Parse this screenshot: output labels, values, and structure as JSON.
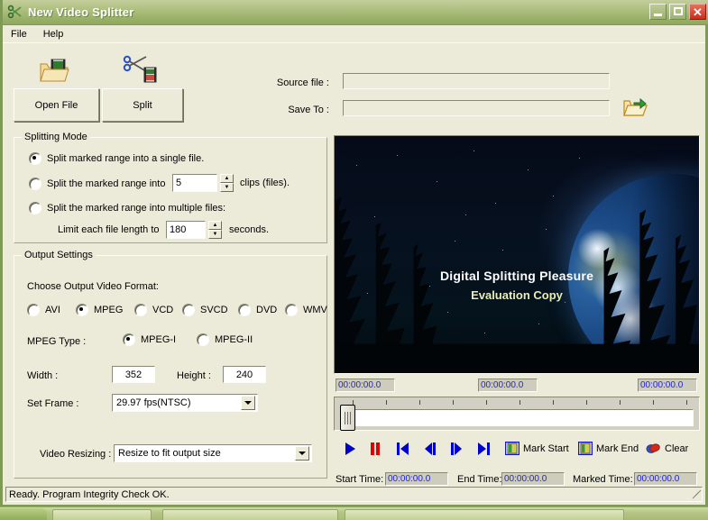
{
  "window": {
    "title": "New Video Splitter",
    "icon": "app-scissors-icon",
    "buttons": {
      "minimize": "_",
      "maximize": "□",
      "close": "✕"
    }
  },
  "menubar": {
    "items": [
      "File",
      "Help"
    ]
  },
  "toolbar": {
    "open_file_label": "Open File",
    "split_label": "Split",
    "open_file_icon": "open-folder-film-icon",
    "split_icon": "scissors-film-icon"
  },
  "file_fields": {
    "source_label": "Source file :",
    "source_value": "",
    "save_label": "Save To :",
    "save_value": "",
    "browse_icon": "browse-folder-icon"
  },
  "splitting_mode": {
    "title": "Splitting Mode",
    "options": [
      {
        "label": "Split marked range into a single file.",
        "selected": true
      },
      {
        "label_before": "Split the marked range into",
        "label_after": "clips (files).",
        "value": "5",
        "selected": false
      },
      {
        "label": "Split the marked range into multiple files:",
        "selected": false
      }
    ],
    "limit_label_before": "Limit each file length to",
    "limit_value": "180",
    "limit_label_after": "seconds."
  },
  "output_settings": {
    "title": "Output Settings",
    "format_label": "Choose Output Video Format:",
    "formats": [
      {
        "label": "AVI",
        "selected": false
      },
      {
        "label": "MPEG",
        "selected": true
      },
      {
        "label": "VCD",
        "selected": false
      },
      {
        "label": "SVCD",
        "selected": false
      },
      {
        "label": "DVD",
        "selected": false
      },
      {
        "label": "WMV",
        "selected": false
      }
    ],
    "mpeg_type_label": "MPEG Type    :",
    "mpeg_types": [
      {
        "label": "MPEG-I",
        "selected": true
      },
      {
        "label": "MPEG-II",
        "selected": false
      }
    ],
    "width_label": "Width :",
    "width_value": "352",
    "height_label": "Height :",
    "height_value": "240",
    "set_frame_label": "Set Frame    :",
    "set_frame_value": "29.97 fps(NTSC)",
    "video_resizing_label": "Video Resizing :",
    "video_resizing_value": "Resize to fit output size"
  },
  "preview": {
    "caption_line1": "Digital Splitting Pleasure",
    "caption_line2": "Evaluation Copy",
    "timecode_left": "00:00:00.0",
    "timecode_center": "00:00:00.0",
    "timecode_right": "00:00:00.0"
  },
  "transport": {
    "play_icon": "play-icon",
    "pause_icon": "pause-icon",
    "prev_icon": "skip-previous-icon",
    "step_back_icon": "step-back-icon",
    "step_forward_icon": "step-forward-icon",
    "next_icon": "skip-next-icon",
    "mark_start_label": "Mark Start",
    "mark_start_icon": "mark-start-film-icon",
    "mark_end_label": "Mark End",
    "mark_end_icon": "mark-end-film-icon",
    "clear_label": "Clear",
    "clear_icon": "eraser-icon"
  },
  "times": {
    "start_label": "Start Time:",
    "start_value": "00:00:00.0",
    "end_label": "End Time:",
    "end_value": "00:00:00.0",
    "marked_label": "Marked Time:",
    "marked_value": "00:00:00.0"
  },
  "status": {
    "text": "Ready. Program Integrity Check OK."
  },
  "colors": {
    "titlebar": "#9bb169",
    "frame_border": "#7e9a54",
    "dialog_face": "#ecead9",
    "timecode_text": "#2323d6",
    "play_blue": "#0000cc",
    "pause_red": "#e00000",
    "caption_yellow": "#e9edb0",
    "close_red": "#cf2a1c"
  }
}
